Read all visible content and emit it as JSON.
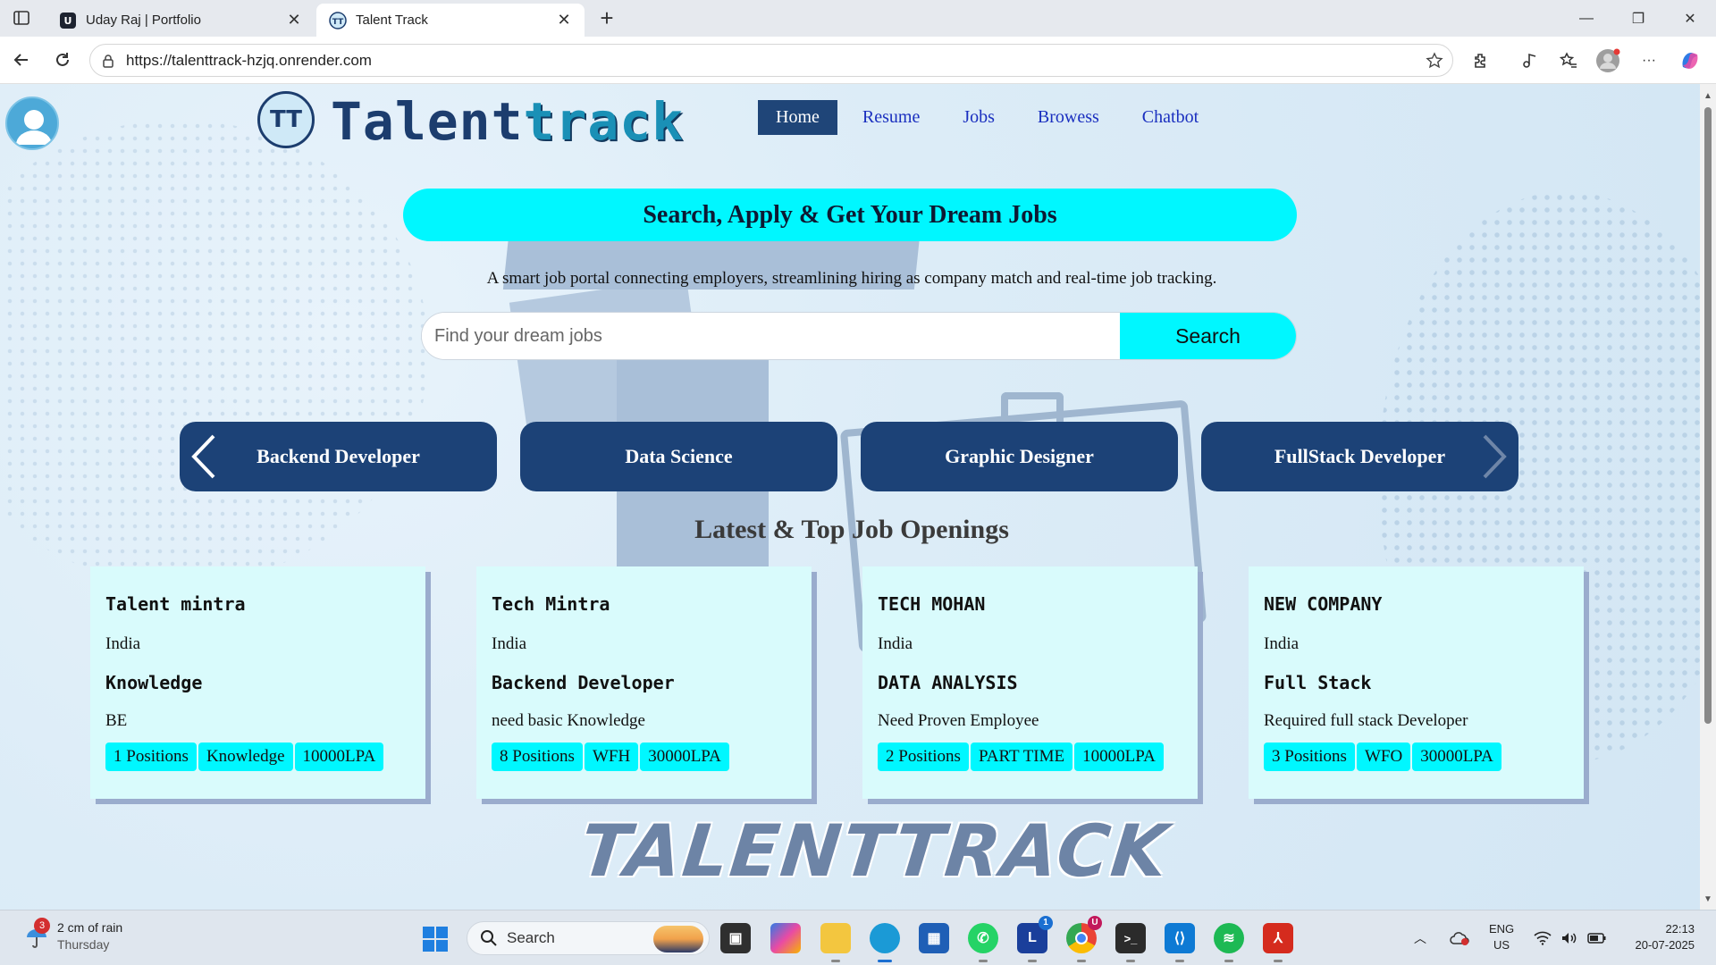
{
  "browser": {
    "tabs": [
      {
        "title": "Uday Raj | Portfolio",
        "active": false
      },
      {
        "title": "Talent Track",
        "active": true
      }
    ],
    "url": "https://talenttrack-hzjq.onrender.com"
  },
  "site": {
    "logo_part1": "Talent",
    "logo_part2": "track",
    "logo_mark": "TT",
    "nav": [
      "Home",
      "Resume",
      "Jobs",
      "Browess",
      "Chatbot"
    ],
    "hero_title": "Search, Apply & Get Your Dream Jobs",
    "tagline": "A smart job portal connecting employers, streamlining hiring as company match and real-time job tracking.",
    "search": {
      "placeholder": "Find your dream jobs",
      "button": "Search"
    },
    "categories": [
      "Backend Developer",
      "Data Science",
      "Graphic Designer",
      "FullStack Developer"
    ],
    "section_title": "Latest & Top Job Openings",
    "jobs": [
      {
        "company": "Talent mintra",
        "location": "India",
        "role": "Knowledge",
        "description": "BE",
        "positions": "1 Positions",
        "type": "Knowledge",
        "salary": "10000LPA"
      },
      {
        "company": "Tech Mintra",
        "location": "India",
        "role": "Backend Developer",
        "description": "need basic Knowledge",
        "positions": "8 Positions",
        "type": "WFH",
        "salary": "30000LPA"
      },
      {
        "company": "TECH MOHAN",
        "location": "India",
        "role": "DATA ANALYSIS",
        "description": "Need Proven Employee",
        "positions": "2 Positions",
        "type": "PART TIME",
        "salary": "10000LPA"
      },
      {
        "company": "NEW COMPANY",
        "location": "India",
        "role": "Full Stack",
        "description": "Required full stack Developer",
        "positions": "3 Positions",
        "type": "WFO",
        "salary": "30000LPA"
      }
    ],
    "footer_logo": "TALENTTRACK"
  },
  "taskbar": {
    "weather_badge": "3",
    "weather_text": "2 cm of rain",
    "weather_day": "Thursday",
    "search_label": "Search",
    "lang_top": "ENG",
    "lang_bottom": "US",
    "time": "22:13",
    "date": "20-07-2025",
    "badge_l": "1",
    "badge_chrome": "U"
  },
  "colors": {
    "accent_cyan": "#00f7ff",
    "navy": "#1c4277",
    "card_bg": "#d9fbfc"
  }
}
